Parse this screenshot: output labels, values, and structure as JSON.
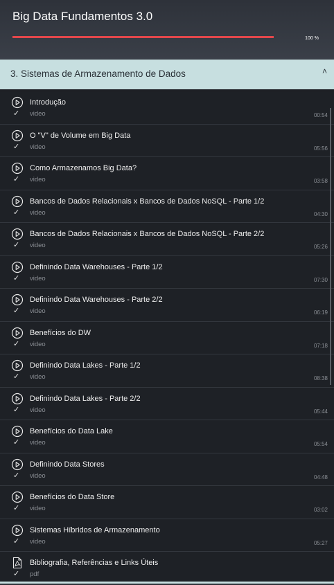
{
  "header": {
    "course_title": "Big Data Fundamentos 3.0",
    "progress_percent": 100,
    "progress_label": "100 %",
    "progress_color": "#e2474b"
  },
  "section": {
    "title": "3. Sistemas de Armazenamento de Dados",
    "chevron": "˄",
    "background": "#c7dfe0"
  },
  "items": [
    {
      "title": "Introdução",
      "type": "video",
      "duration": "00:54",
      "icon": "play-circle-icon",
      "completed": true
    },
    {
      "title": "O \"V\" de Volume em Big Data",
      "type": "video",
      "duration": "05:56",
      "icon": "play-circle-icon",
      "completed": true
    },
    {
      "title": "Como Armazenamos Big Data?",
      "type": "video",
      "duration": "03:58",
      "icon": "play-circle-icon",
      "completed": true
    },
    {
      "title": "Bancos de Dados Relacionais x Bancos de Dados NoSQL - Parte 1/2",
      "type": "video",
      "duration": "04:30",
      "icon": "play-circle-icon",
      "completed": true
    },
    {
      "title": "Bancos de Dados Relacionais x Bancos de Dados NoSQL - Parte 2/2",
      "type": "video",
      "duration": "05:26",
      "icon": "play-circle-icon",
      "completed": true
    },
    {
      "title": "Definindo Data Warehouses - Parte 1/2",
      "type": "video",
      "duration": "07:30",
      "icon": "play-circle-icon",
      "completed": true
    },
    {
      "title": "Definindo Data Warehouses - Parte 2/2",
      "type": "video",
      "duration": "06:19",
      "icon": "play-circle-icon",
      "completed": true
    },
    {
      "title": "Benefícios do DW",
      "type": "video",
      "duration": "07:18",
      "icon": "play-circle-icon",
      "completed": true
    },
    {
      "title": "Definindo Data Lakes - Parte 1/2",
      "type": "video",
      "duration": "08:38",
      "icon": "play-circle-icon",
      "completed": true
    },
    {
      "title": "Definindo Data Lakes - Parte 2/2",
      "type": "video",
      "duration": "05:44",
      "icon": "play-circle-icon",
      "completed": true
    },
    {
      "title": "Benefícios do Data Lake",
      "type": "video",
      "duration": "05:54",
      "icon": "play-circle-icon",
      "completed": true
    },
    {
      "title": "Definindo Data Stores",
      "type": "video",
      "duration": "04:48",
      "icon": "play-circle-icon",
      "completed": true
    },
    {
      "title": "Benefícios do Data Store",
      "type": "video",
      "duration": "03:02",
      "icon": "play-circle-icon",
      "completed": true
    },
    {
      "title": "Sistemas Híbridos de Armazenamento",
      "type": "video",
      "duration": "05:27",
      "icon": "play-circle-icon",
      "completed": true
    },
    {
      "title": "Bibliografia, Referências e Links Úteis",
      "type": "pdf",
      "duration": "",
      "icon": "pdf-icon",
      "completed": true
    }
  ]
}
